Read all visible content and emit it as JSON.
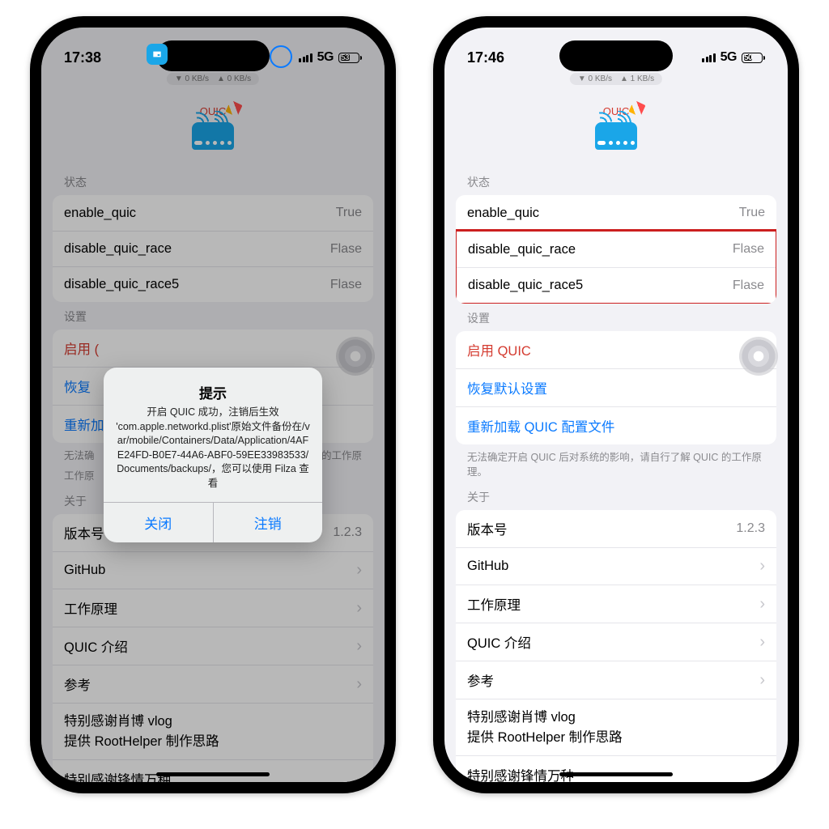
{
  "phones": {
    "left": {
      "time": "17:38",
      "network": "5G",
      "battery": "53",
      "speed_down": "▼ 0 KB/s",
      "speed_up": "▲ 0 KB/s"
    },
    "right": {
      "time": "17:46",
      "network": "5G",
      "battery": "50",
      "speed_down": "▼ 0 KB/s",
      "speed_up": "▲ 1 KB/s"
    }
  },
  "header": {
    "quic": "QUIC"
  },
  "sections": {
    "status_header": "状态",
    "settings_header": "设置",
    "about_header": "关于"
  },
  "status": {
    "enable_quic": {
      "label": "enable_quic",
      "value": "True"
    },
    "disable_quic_race": {
      "label": "disable_quic_race",
      "value": "Flase"
    },
    "disable_quic_race5": {
      "label": "disable_quic_race5",
      "value": "Flase"
    }
  },
  "settings": {
    "enable": "启用 QUIC",
    "restore": "恢复默认设置",
    "reload": "重新加载 QUIC 配置文件",
    "left_enable_clipped": "启用 (",
    "left_restore_clipped": "恢复",
    "left_reload_clipped": "重新加",
    "footer": "无法确定开启 QUIC 后对系统的影响，请自行了解 QUIC 的工作原理。",
    "footer_left_prefix": "无法确",
    "footer_left_suffix": "C 的工作原",
    "left_char": "C 的"
  },
  "about": {
    "version_label": "版本号",
    "version_value": "1.2.3",
    "github": "GitHub",
    "how": "工作原理",
    "quic_intro": "QUIC 介绍",
    "refs": "参考",
    "thanks1a": "特别感谢肖博 vlog",
    "thanks1b": "提供 RootHelper 制作思路",
    "thanks2": "特别感谢锋情万种"
  },
  "alert": {
    "title": "提示",
    "message": "开启 QUIC 成功，注销后生效\n'com.apple.networkd.plist'原始文件备份在/var/mobile/Containers/Data/Application/4AFE24FD-B0E7-44A6-ABF0-59EE33983533/Documents/backups/，您可以使用 Filza 查看",
    "close": "关闭",
    "logout": "注销"
  }
}
